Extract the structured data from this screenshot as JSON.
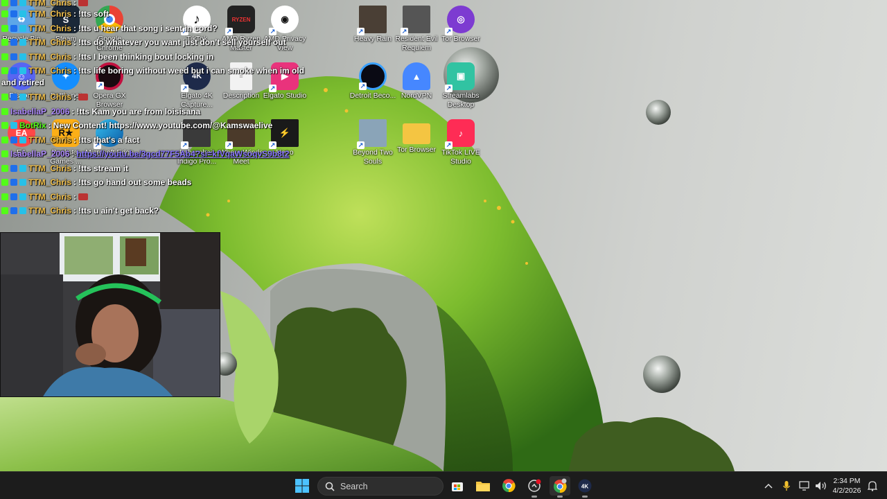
{
  "desktop": {
    "icons": [
      {
        "label": "Recycle Bin",
        "icon": "recycle-bin-icon",
        "color": "#5da6e8"
      },
      {
        "label": "Steam",
        "icon": "steam-icon",
        "color": "#1b2838"
      },
      {
        "label": "Google Chrome",
        "icon": "chrome-icon",
        "color": "#e8453c"
      },
      {
        "label": "TikTok",
        "icon": "tiktok-icon",
        "color": "#111111"
      },
      {
        "label": "AMD Ryzen Master",
        "icon": "amd-ryzen-icon",
        "color": "#222222"
      },
      {
        "label": "AMD Privacy View",
        "icon": "amd-privacy-icon",
        "color": "#1a1a1a"
      },
      {
        "label": "Heavy Rain",
        "icon": "heavy-rain-icon",
        "color": "#4a3f35"
      },
      {
        "label": "Resident Evil Requiem",
        "icon": "resident-evil-icon",
        "color": "#555555"
      },
      {
        "label": "Tor Browser",
        "icon": "tor-icon",
        "color": "#7d3bd1"
      },
      {
        "label": "Discord",
        "icon": "discord-icon",
        "color": "#5865f2"
      },
      {
        "label": "Battle.net",
        "icon": "battlenet-icon",
        "color": "#148eff"
      },
      {
        "label": "Opera GX Browser",
        "icon": "opera-gx-icon",
        "color": "#c2103f"
      },
      {
        "label": "Elgato 4K Capture...",
        "icon": "elgato-4k-icon",
        "color": "#1e2a4a"
      },
      {
        "label": "Description",
        "icon": "document-icon",
        "color": "#f2f2f2"
      },
      {
        "label": "Elgato Studio",
        "icon": "elgato-studio-icon",
        "color": "#e9337c"
      },
      {
        "label": "Detroit Beco...",
        "icon": "detroit-icon",
        "color": "#0a0a14"
      },
      {
        "label": "NordVPN",
        "icon": "nordvpn-icon",
        "color": "#4687ff"
      },
      {
        "label": "Streamlabs Desktop",
        "icon": "streamlabs-icon",
        "color": "#31c3a2"
      },
      {
        "label": "EA",
        "icon": "ea-icon",
        "color": "#ff4747"
      },
      {
        "label": "Rockstar Games ...",
        "icon": "rockstar-icon",
        "color": "#fcaf17"
      },
      {
        "label": "Microsoft Edge",
        "icon": "edge-icon",
        "color": "#0c8cd8"
      },
      {
        "label": "Fahrenheit Indigo Pro...",
        "icon": "fahrenheit-icon",
        "color": "#3a3a3a"
      },
      {
        "label": "Where Winds Meet",
        "icon": "where-winds-icon",
        "color": "#4b3a2a"
      },
      {
        "label": "Hono",
        "icon": "hono-icon",
        "color": "#1a1a1a"
      },
      {
        "label": "Beyond Two Souls",
        "icon": "beyond-icon",
        "color": "#8aa4b8"
      },
      {
        "label": "Tor Browser",
        "icon": "folder-icon",
        "color": "#f4c542"
      },
      {
        "label": "TikTok LIVE Studio",
        "icon": "tiktok-live-icon",
        "color": "#fe2c55"
      }
    ]
  },
  "chat": {
    "lines": [
      {
        "user": "TTM_Chris",
        "sep": " : ",
        "msg": "",
        "emote": true,
        "badges": 3,
        "kind": "chris"
      },
      {
        "user": "TTM_Chris",
        "sep": " : ",
        "msg": "!tts soft",
        "badges": 3,
        "kind": "chris"
      },
      {
        "user": "TTM_Chris",
        "sep": " : ",
        "msg": "!tts u hear that song i sent in cord?",
        "badges": 3,
        "kind": "chris"
      },
      {
        "user": "TTM_Chris",
        "sep": " : ",
        "msg": "!tts do whatever you want just don't sell yourself out",
        "badges": 3,
        "kind": "chris"
      },
      {
        "user": "TTM_Chris",
        "sep": " : ",
        "msg": "!tts I been thinking bout locking in",
        "badges": 3,
        "kind": "chris"
      },
      {
        "user": "TTM_Chris",
        "sep": " : ",
        "msg": "!tts life boring without weed but i can smoke when im old",
        "badges": 3,
        "kind": "chris"
      },
      {
        "user": "",
        "sep": "",
        "msg": "and retired",
        "badges": 0,
        "kind": "cont"
      },
      {
        "user": "TTM_Chris",
        "sep": " : ",
        "msg": "",
        "emote": true,
        "badges": 3,
        "kind": "chris"
      },
      {
        "user": "IsabellaP_2006",
        "sep": " : ",
        "msg": "!tts Kam you are from loisisana",
        "badges": 1,
        "kind": "bella"
      },
      {
        "user": "BotRix",
        "sep": " : ",
        "msg": "New Content! https://www.youtube.com/@Kamswaelive",
        "badges": 2,
        "kind": "bot"
      },
      {
        "user": "TTM_Chris",
        "sep": " : ",
        "msg": "!tts that's a fact",
        "badges": 3,
        "kind": "chris"
      },
      {
        "user": "IsabellaP_2006",
        "sep": " : ",
        "msg": "https://youtu.be/3gcd77F5Ab4?si=kfVqaWsoqvS9b8t2",
        "badges": 1,
        "kind": "bella-link"
      },
      {
        "user": "TTM_Chris",
        "sep": " : ",
        "msg": "!tts stream it",
        "badges": 3,
        "kind": "chris"
      },
      {
        "user": "TTM_Chris",
        "sep": " : ",
        "msg": "!tts go hand out some beads",
        "badges": 3,
        "kind": "chris"
      },
      {
        "user": "TTM_Chris",
        "sep": " : ",
        "msg": "",
        "emote": true,
        "badges": 3,
        "kind": "chris"
      },
      {
        "user": "TTM_Chris",
        "sep": " : ",
        "msg": "!tts u ain't get back?",
        "badges": 3,
        "kind": "chris"
      }
    ]
  },
  "taskbar": {
    "search_placeholder": "Search",
    "apps": [
      "start-icon",
      "search-icon",
      "store-icon",
      "file-explorer-icon",
      "chrome-icon",
      "streamlabs-recording-icon",
      "chrome-profile-icon",
      "elgato-4k-icon"
    ],
    "clock_time": "2:34 PM",
    "clock_date": "4/2/2026"
  }
}
